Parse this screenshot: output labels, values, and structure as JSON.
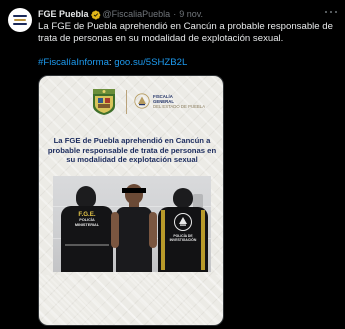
{
  "tweet": {
    "display_name": "FGE Puebla",
    "verified_icon": "verified-badge-icon",
    "handle": "@FiscaliaPuebla",
    "separator": "·",
    "date": "9 nov.",
    "text": "La FGE de Puebla aprehendió en Cancún a probable responsable de trata de personas en su modalidad de explotación sexual.",
    "hashtag": "#FiscalíaInforma",
    "link_separator": ": ",
    "link": "goo.su/5SHZB2L"
  },
  "media": {
    "fge_logo_title": "FISCALÍA",
    "fge_logo_title2": "GENERAL",
    "fge_logo_sub": "DEL ESTADO DE PUEBLA",
    "headline": "La FGE de Puebla aprehendió en Cancún a probable responsable de trata de personas en su modalidad de explotación sexual",
    "vest_left_line1": "F.G.E.",
    "vest_left_line2": "POLICÍA",
    "vest_left_line3": "MINISTERIAL",
    "vest_right_line1": "POLICÍA DE",
    "vest_right_line2": "INVESTIGACIÓN"
  },
  "colors": {
    "background": "#000000",
    "text": "#e7e9ea",
    "muted": "#71767b",
    "link": "#1d9bf0",
    "verified": "#e2b719",
    "headline": "#1c2c5e"
  }
}
